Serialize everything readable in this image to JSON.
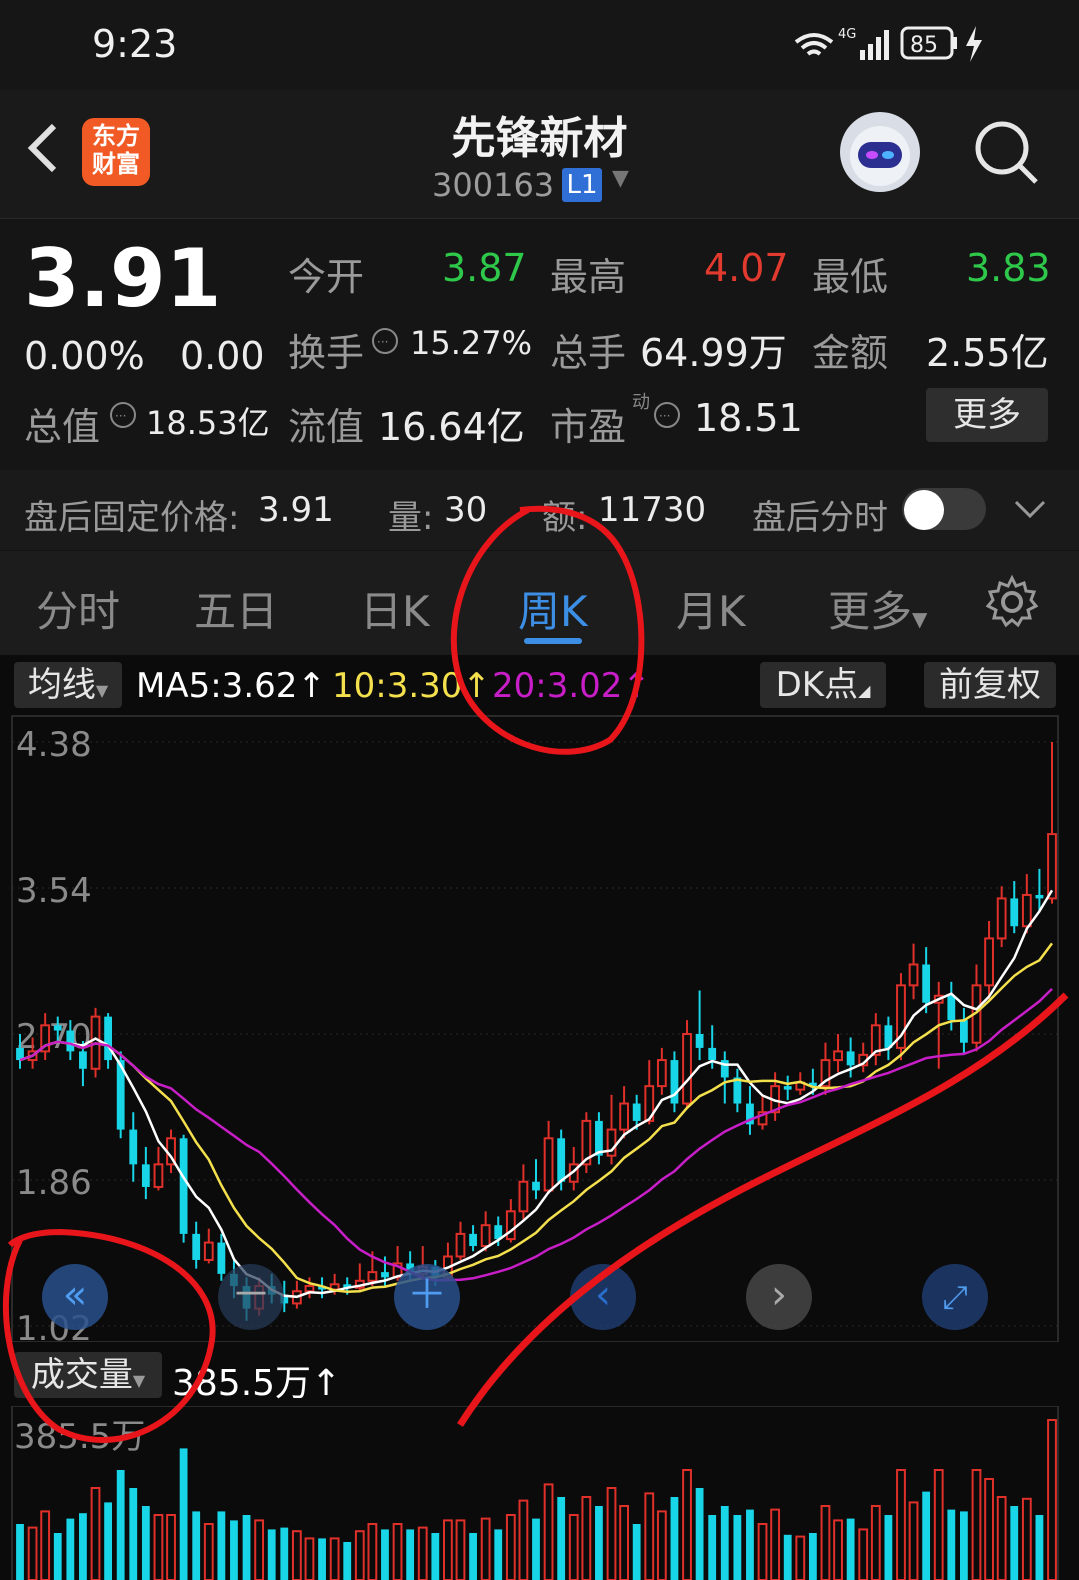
{
  "status_bar": {
    "time": "9:23",
    "network": "4G",
    "battery": "85"
  },
  "header": {
    "app_logo": "东方\n财富",
    "stock_name": "先锋新材",
    "stock_code": "300163",
    "level_badge": "L1"
  },
  "quote": {
    "price": "3.91",
    "change_pct": "0.00%",
    "change": "0.00",
    "open_label": "今开",
    "open": "3.87",
    "high_label": "最高",
    "high": "4.07",
    "low_label": "最低",
    "low": "3.83",
    "turnover_label": "换手",
    "turnover": "15.27%",
    "volume_label": "总手",
    "volume": "64.99万",
    "amount_label": "金额",
    "amount": "2.55亿",
    "mcap_label": "总值",
    "mcap": "18.53亿",
    "float_label": "流值",
    "float": "16.64亿",
    "pe_label": "市盈",
    "pe_sup": "动",
    "pe": "18.51",
    "more": "更多"
  },
  "after_hours": {
    "price_label": "盘后固定价格:",
    "price": "3.91",
    "qty_label": "量:",
    "qty": "30",
    "amt_label": "额:",
    "amt": "11730",
    "toggle_label": "盘后分时"
  },
  "tabs": [
    "分时",
    "五日",
    "日K",
    "周K",
    "月K",
    "更多"
  ],
  "active_tab": "周K",
  "indicators": {
    "ma_selector": "均线",
    "ma5": "MA5:3.62",
    "ma10": "10:3.30",
    "ma20": "20:3.02",
    "dk_btn": "DK点",
    "adjust_btn": "前复权",
    "colors": {
      "ma5": "#ffffff",
      "ma10": "#f4e04d",
      "ma20": "#c81ec8",
      "up": "#e0302a",
      "down": "#18d6e8"
    }
  },
  "chart_data": {
    "type": "candlestick",
    "y_ticks": [
      "4.38",
      "3.54",
      "2.70",
      "1.86",
      "1.02"
    ],
    "ylim": [
      1.02,
      4.38
    ],
    "candles": [
      [
        2.62,
        2.55,
        2.7,
        2.5
      ],
      [
        2.55,
        2.6,
        2.68,
        2.5
      ],
      [
        2.6,
        2.75,
        2.82,
        2.55
      ],
      [
        2.75,
        2.72,
        2.8,
        2.65
      ],
      [
        2.72,
        2.6,
        2.78,
        2.55
      ],
      [
        2.6,
        2.5,
        2.66,
        2.4
      ],
      [
        2.5,
        2.8,
        2.85,
        2.45
      ],
      [
        2.8,
        2.55,
        2.82,
        2.5
      ],
      [
        2.55,
        2.15,
        2.6,
        2.1
      ],
      [
        2.15,
        1.95,
        2.25,
        1.85
      ],
      [
        1.95,
        1.82,
        2.05,
        1.75
      ],
      [
        1.82,
        1.95,
        2.05,
        1.8
      ],
      [
        1.95,
        2.1,
        2.15,
        1.9
      ],
      [
        2.1,
        1.55,
        2.12,
        1.5
      ],
      [
        1.55,
        1.4,
        1.62,
        1.35
      ],
      [
        1.4,
        1.5,
        1.58,
        1.38
      ],
      [
        1.5,
        1.32,
        1.55,
        1.28
      ],
      [
        1.32,
        1.25,
        1.4,
        1.18
      ],
      [
        1.25,
        1.12,
        1.3,
        1.05
      ],
      [
        1.12,
        1.25,
        1.3,
        1.08
      ],
      [
        1.25,
        1.2,
        1.32,
        1.15
      ],
      [
        1.2,
        1.15,
        1.28,
        1.1
      ],
      [
        1.15,
        1.22,
        1.28,
        1.12
      ],
      [
        1.22,
        1.25,
        1.3,
        1.18
      ],
      [
        1.25,
        1.23,
        1.3,
        1.18
      ],
      [
        1.23,
        1.26,
        1.32,
        1.2
      ],
      [
        1.26,
        1.24,
        1.3,
        1.2
      ],
      [
        1.24,
        1.28,
        1.38,
        1.22
      ],
      [
        1.28,
        1.33,
        1.45,
        1.25
      ],
      [
        1.33,
        1.3,
        1.42,
        1.25
      ],
      [
        1.3,
        1.38,
        1.48,
        1.28
      ],
      [
        1.38,
        1.32,
        1.45,
        1.28
      ],
      [
        1.32,
        1.36,
        1.48,
        1.3
      ],
      [
        1.36,
        1.3,
        1.4,
        1.25
      ],
      [
        1.3,
        1.42,
        1.5,
        1.28
      ],
      [
        1.42,
        1.55,
        1.62,
        1.4
      ],
      [
        1.55,
        1.48,
        1.6,
        1.45
      ],
      [
        1.48,
        1.6,
        1.68,
        1.45
      ],
      [
        1.6,
        1.52,
        1.65,
        1.48
      ],
      [
        1.52,
        1.68,
        1.75,
        1.5
      ],
      [
        1.68,
        1.85,
        1.95,
        1.62
      ],
      [
        1.85,
        1.8,
        1.98,
        1.75
      ],
      [
        1.8,
        2.1,
        2.2,
        1.78
      ],
      [
        2.1,
        1.85,
        2.15,
        1.8
      ],
      [
        1.85,
        1.95,
        2.05,
        1.8
      ],
      [
        1.95,
        2.2,
        2.25,
        1.9
      ],
      [
        2.2,
        2.0,
        2.25,
        1.95
      ],
      [
        2.0,
        2.15,
        2.35,
        1.95
      ],
      [
        2.15,
        2.3,
        2.4,
        2.1
      ],
      [
        2.3,
        2.2,
        2.35,
        2.15
      ],
      [
        2.2,
        2.4,
        2.55,
        2.18
      ],
      [
        2.4,
        2.55,
        2.62,
        2.35
      ],
      [
        2.55,
        2.3,
        2.6,
        2.25
      ],
      [
        2.3,
        2.7,
        2.78,
        2.28
      ],
      [
        2.7,
        2.62,
        2.95,
        2.55
      ],
      [
        2.62,
        2.55,
        2.75,
        2.5
      ],
      [
        2.55,
        2.45,
        2.6,
        2.3
      ],
      [
        2.45,
        2.3,
        2.5,
        2.25
      ],
      [
        2.3,
        2.18,
        2.4,
        2.12
      ],
      [
        2.18,
        2.25,
        2.35,
        2.15
      ],
      [
        2.25,
        2.4,
        2.48,
        2.2
      ],
      [
        2.4,
        2.38,
        2.46,
        2.32
      ],
      [
        2.38,
        2.42,
        2.48,
        2.35
      ],
      [
        2.42,
        2.4,
        2.5,
        2.35
      ],
      [
        2.4,
        2.55,
        2.65,
        2.35
      ],
      [
        2.55,
        2.6,
        2.7,
        2.48
      ],
      [
        2.6,
        2.52,
        2.68,
        2.45
      ],
      [
        2.52,
        2.58,
        2.65,
        2.48
      ],
      [
        2.58,
        2.75,
        2.82,
        2.52
      ],
      [
        2.75,
        2.62,
        2.8,
        2.55
      ],
      [
        2.62,
        2.98,
        3.05,
        2.55
      ],
      [
        2.98,
        3.1,
        3.22,
        2.9
      ],
      [
        3.1,
        2.88,
        3.2,
        2.82
      ],
      [
        2.88,
        2.92,
        3.0,
        2.5
      ],
      [
        2.92,
        2.78,
        3.0,
        2.72
      ],
      [
        2.78,
        2.65,
        2.85,
        2.58
      ],
      [
        2.65,
        2.98,
        3.1,
        2.6
      ],
      [
        2.98,
        3.25,
        3.35,
        2.9
      ],
      [
        3.25,
        3.48,
        3.55,
        3.2
      ],
      [
        3.48,
        3.32,
        3.58,
        3.28
      ],
      [
        3.32,
        3.5,
        3.62,
        3.28
      ],
      [
        3.5,
        3.48,
        3.65,
        3.4
      ],
      [
        3.48,
        3.85,
        4.38,
        3.45
      ]
    ]
  },
  "controls": {
    "rewind_icon": "double-chevron-left-icon",
    "add_icon": "plus-icon",
    "prev_icon": "chevron-left-icon",
    "next_icon": "chevron-right-icon",
    "expand_icon": "expand-icon"
  },
  "volume_panel": {
    "selector": "成交量",
    "value": "385.5万↑",
    "top_tick": "385.5万"
  }
}
